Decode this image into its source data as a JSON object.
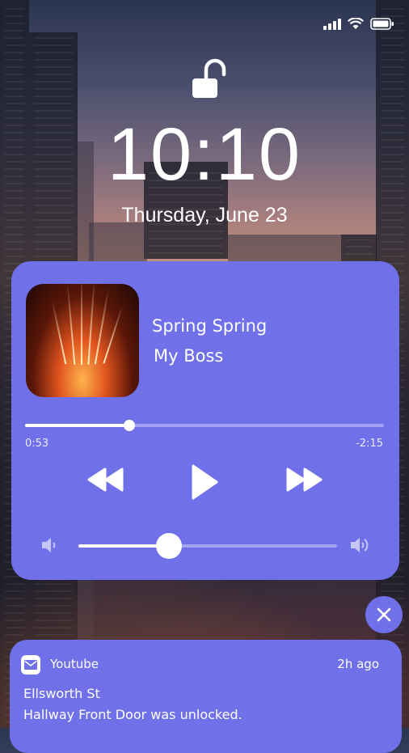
{
  "lock_screen": {
    "time": "10:10",
    "date": "Thursday, June 23"
  },
  "now_playing": {
    "title": "Spring Spring",
    "artist": "My Boss",
    "elapsed": "0:53",
    "remaining": "-2:15",
    "progress_fraction": 0.29,
    "volume_fraction": 0.35
  },
  "notification": {
    "app": "Youtube",
    "time": "2h ago",
    "title": "Ellsworth St",
    "body": "Hallway Front Door was unlocked."
  },
  "icons": [
    "signal-icon",
    "wifi-icon",
    "battery-icon",
    "unlock-icon",
    "rewind-icon",
    "play-icon",
    "fast-forward-icon",
    "volume-low-icon",
    "volume-high-icon",
    "close-icon",
    "mail-icon"
  ],
  "colors": {
    "card": "#7070e8",
    "foreground": "#ffffff"
  }
}
